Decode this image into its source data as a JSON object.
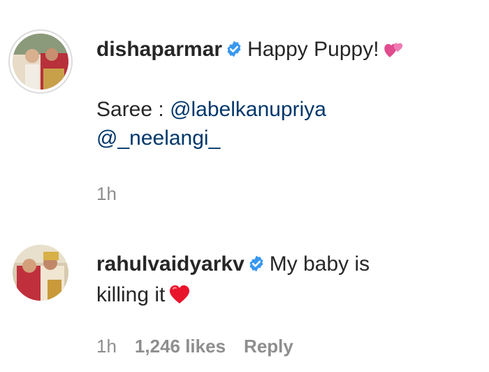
{
  "comments": [
    {
      "username": "dishaparmar",
      "verified": true,
      "text_line1": "Happy Puppy!",
      "emoji1": "two-hearts-icon",
      "caption_prefix": "Saree : ",
      "mention1": "@labelkanupriya",
      "mention2": "@_neelangi_",
      "time": "1h"
    },
    {
      "username": "rahulvaidyarkv",
      "verified": true,
      "text_part1": "My baby is",
      "text_part2": "killing it",
      "emoji": "red-heart-icon",
      "time": "1h",
      "likes": "1,246 likes",
      "reply": "Reply"
    }
  ],
  "colors": {
    "text": "#262626",
    "mention": "#00376b",
    "meta": "#8e8e8e",
    "verified": "#3897f0"
  }
}
